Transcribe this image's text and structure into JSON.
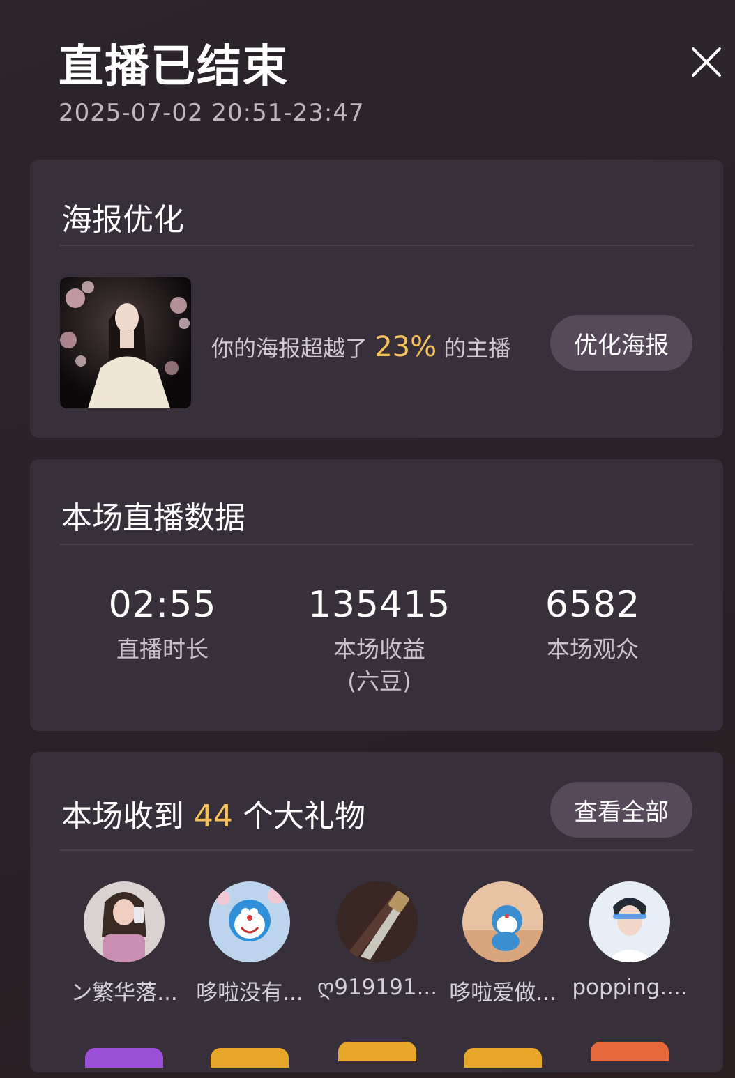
{
  "header": {
    "title": "直播已结束",
    "time_range": "2025-07-02 20:51-23:47"
  },
  "poster": {
    "title": "海报优化",
    "text_prefix": "你的海报超越了",
    "percent": "23%",
    "text_suffix": "的主播",
    "button_label": "优化海报"
  },
  "stats": {
    "title": "本场直播数据",
    "items": [
      {
        "value": "02:55",
        "label": "直播时长"
      },
      {
        "value": "135415",
        "label": "本场收益\n(六豆)"
      },
      {
        "value": "6582",
        "label": "本场观众"
      }
    ]
  },
  "gifts": {
    "title_prefix": "本场收到",
    "count": "44",
    "title_suffix": "个大礼物",
    "button_label": "查看全部",
    "gifters": [
      {
        "name": "ン繁华落...",
        "badge_color": "#9b4fd6"
      },
      {
        "name": "哆啦没有...",
        "badge_color": "#e7a52a"
      },
      {
        "name": "ღ919191...",
        "badge_color": "#e7a52a"
      },
      {
        "name": "哆啦爱做...",
        "badge_color": "#e7a52a"
      },
      {
        "name": "popping....",
        "badge_color": "#e5693a"
      }
    ]
  },
  "colors": {
    "accent": "#f4c15c",
    "card_bg": "#37303a",
    "button_bg": "#55495a"
  }
}
